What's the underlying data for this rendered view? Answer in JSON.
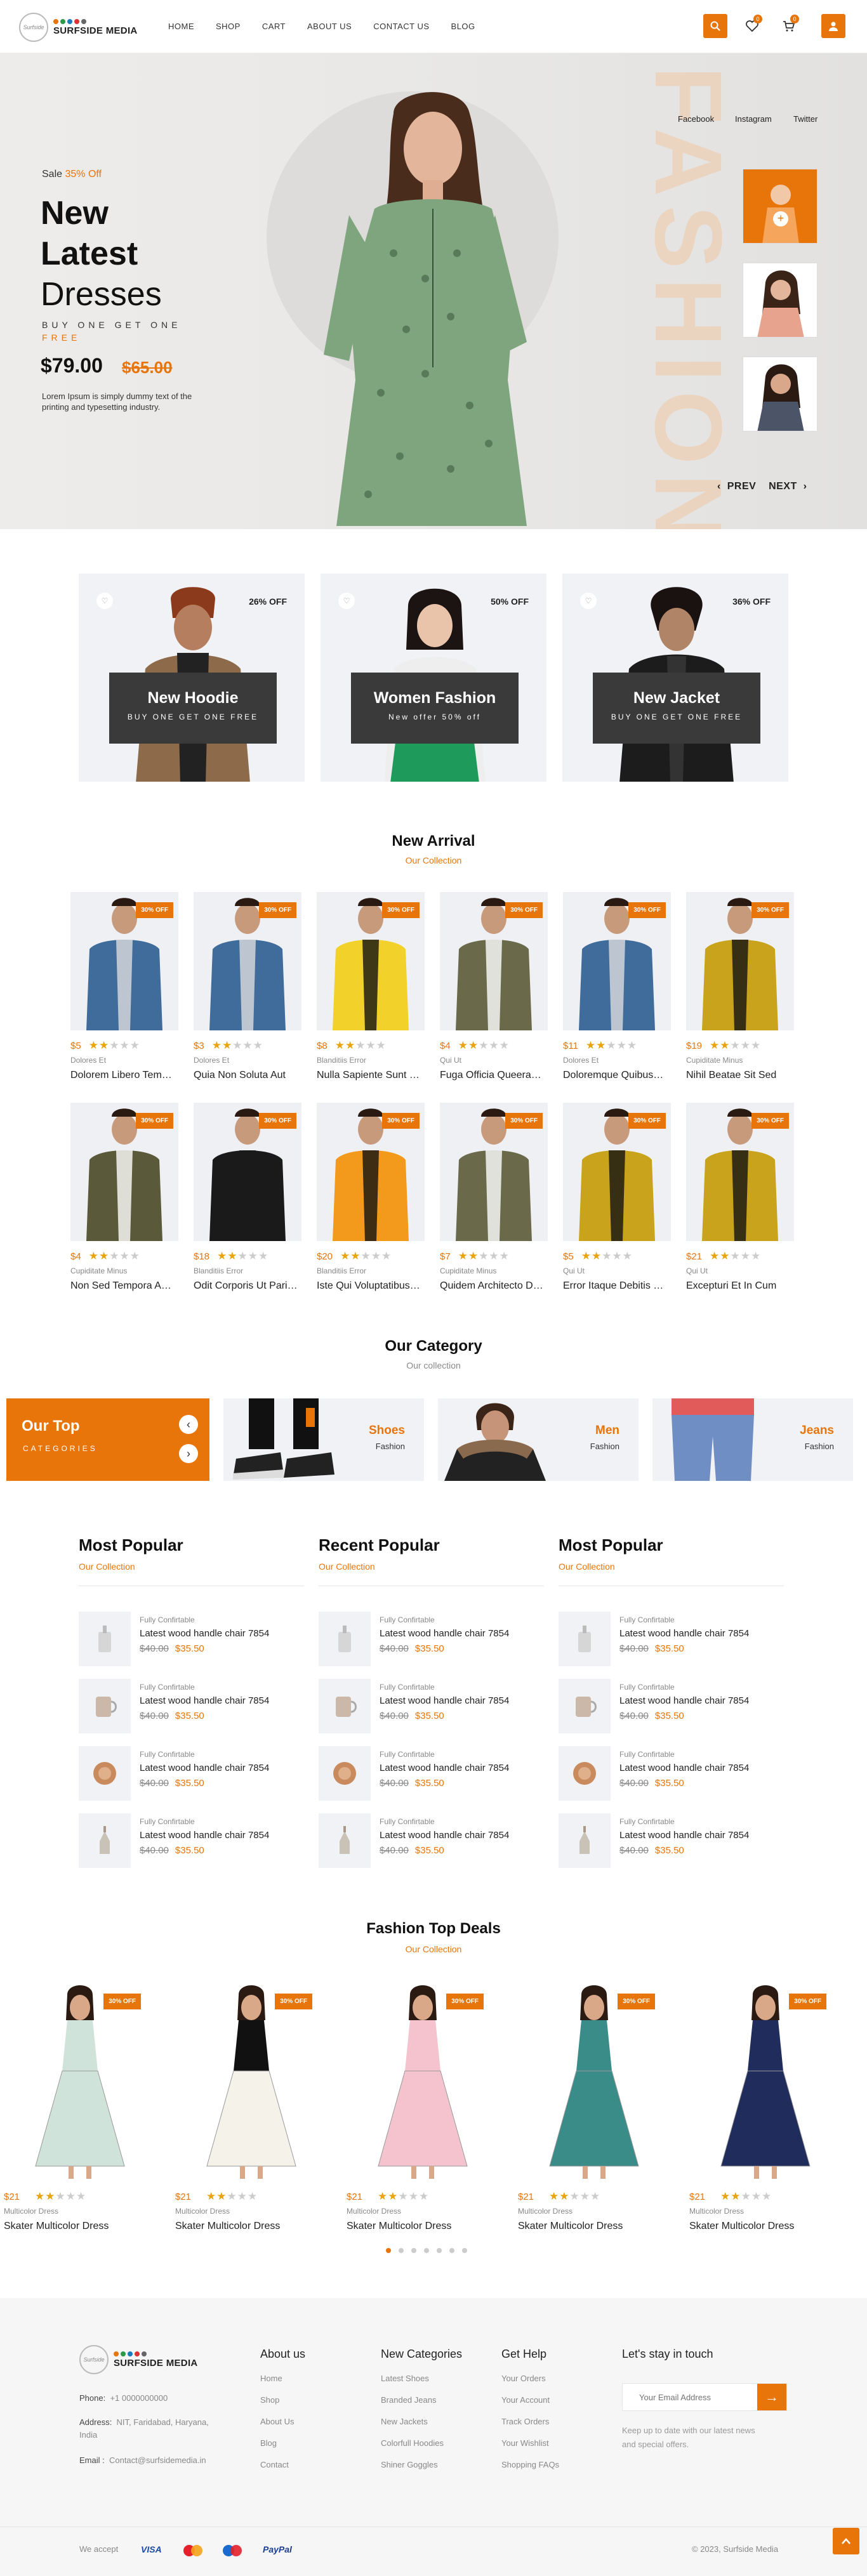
{
  "header": {
    "logo_text": "SURFSIDE MEDIA",
    "logo_script": "Surfside",
    "nav": [
      "HOME",
      "SHOP",
      "CART",
      "ABOUT US",
      "CONTACT US",
      "BLOG"
    ],
    "wishlist_count": "0",
    "cart_count": "0"
  },
  "hero": {
    "sale_label": "Sale",
    "sale_off": "35% Off",
    "title_line1": "New",
    "title_line2": "Latest",
    "title_line3": "Dresses",
    "buy_text": "BUY ONE GET ONE",
    "free_text": "FREE",
    "price": "$79.00",
    "old_price": "$65.00",
    "description": "Lorem Ipsum is simply dummy text of the printing and typesetting industry.",
    "bg_word": "FASHION",
    "social": [
      "Facebook",
      "Instagram",
      "Twitter"
    ],
    "prev": "PREV",
    "next": "NEXT"
  },
  "promos": [
    {
      "off": "26% OFF",
      "title": "New Hoodie",
      "subtitle": "BUY ONE GET ONE FREE"
    },
    {
      "off": "50% OFF",
      "title": "Women Fashion",
      "subtitle": "New offer 50% off"
    },
    {
      "off": "36% OFF",
      "title": "New Jacket",
      "subtitle": "BUY ONE GET ONE FREE"
    }
  ],
  "new_arrival": {
    "title": "New Arrival",
    "subtitle": "Our Collection",
    "tag": "30% OFF",
    "products": [
      {
        "price": "$5",
        "rating": 2,
        "category": "Dolores Et",
        "name": "Dolorem Libero Tem…"
      },
      {
        "price": "$3",
        "rating": 2,
        "category": "Dolores Et",
        "name": "Quia Non Soluta Aut"
      },
      {
        "price": "$8",
        "rating": 2,
        "category": "Blanditiis Error",
        "name": "Nulla Sapiente Sunt …"
      },
      {
        "price": "$4",
        "rating": 2,
        "category": "Qui Ut",
        "name": "Fuga Officia Queera…"
      },
      {
        "price": "$11",
        "rating": 2,
        "category": "Dolores Et",
        "name": "Doloremque Quibus…"
      },
      {
        "price": "$19",
        "rating": 2,
        "category": "Cupiditate Minus",
        "name": "Nihil Beatae Sit Sed"
      },
      {
        "price": "$4",
        "rating": 2,
        "category": "Cupiditate Minus",
        "name": "Non Sed Tempora A…"
      },
      {
        "price": "$18",
        "rating": 2,
        "category": "Blanditiis Error",
        "name": "Odit Corporis Ut Pari…"
      },
      {
        "price": "$20",
        "rating": 2,
        "category": "Blanditiis Error",
        "name": "Iste Qui Voluptatibus…"
      },
      {
        "price": "$7",
        "rating": 2,
        "category": "Cupiditate Minus",
        "name": "Quidem Architecto D…"
      },
      {
        "price": "$5",
        "rating": 2,
        "category": "Qui Ut",
        "name": "Error Itaque Debitis …"
      },
      {
        "price": "$21",
        "rating": 2,
        "category": "Qui Ut",
        "name": "Excepturi Et In Cum"
      }
    ]
  },
  "category": {
    "title": "Our Category",
    "subtitle": "Our collection",
    "top_title": "Our Top",
    "top_sub": "CATEGORIES",
    "items": [
      {
        "name": "Shoes",
        "sub": "Fashion"
      },
      {
        "name": "Men",
        "sub": "Fashion"
      },
      {
        "name": "Jeans",
        "sub": "Fashion"
      }
    ]
  },
  "lists": [
    {
      "title": "Most Popular",
      "subtitle": "Our Collection"
    },
    {
      "title": "Recent Popular",
      "subtitle": "Our Collection"
    },
    {
      "title": "Most Popular",
      "subtitle": "Our Collection"
    }
  ],
  "list_item": {
    "category": "Fully Confirtable",
    "items": [
      {
        "name": "Latest wood handle chair 7854",
        "old": "$40.00",
        "price": "$35.50"
      },
      {
        "name": "Latest wood handle chair 7854",
        "old": "$40.00",
        "price": "$35.50"
      },
      {
        "name": "Latest wood handle chair 7854",
        "old": "$40.00",
        "price": "$35.50"
      },
      {
        "name": "Latest wood handle chair 7854",
        "old": "$40.00",
        "price": "$35.50"
      }
    ]
  },
  "deals": {
    "title": "Fashion Top Deals",
    "subtitle": "Our Collection",
    "tag": "30% OFF",
    "products": [
      {
        "price": "$21",
        "rating": 2,
        "category": "Multicolor Dress",
        "name": "Skater Multicolor Dress"
      },
      {
        "price": "$21",
        "rating": 2,
        "category": "Multicolor Dress",
        "name": "Skater Multicolor Dress"
      },
      {
        "price": "$21",
        "rating": 2,
        "category": "Multicolor Dress",
        "name": "Skater Multicolor Dress"
      },
      {
        "price": "$21",
        "rating": 2,
        "category": "Multicolor Dress",
        "name": "Skater Multicolor Dress"
      },
      {
        "price": "$21",
        "rating": 2,
        "category": "Multicolor Dress",
        "name": "Skater Multicolor Dress"
      }
    ],
    "active_dot": 0
  },
  "footer": {
    "logo_text": "SURFSIDE MEDIA",
    "phone_label": "Phone:",
    "phone": "+1 0000000000",
    "address_label": "Address:",
    "address": "NIT, Faridabad, Haryana, India",
    "email_label": "Email :",
    "email": "Contact@surfsidemedia.in",
    "about_title": "About us",
    "about_links": [
      "Home",
      "Shop",
      "About Us",
      "Blog",
      "Contact"
    ],
    "cat_title": "New Categories",
    "cat_links": [
      "Latest Shoes",
      "Branded Jeans",
      "New Jackets",
      "Colorfull Hoodies",
      "Shiner Goggles"
    ],
    "help_title": "Get Help",
    "help_links": [
      "Your Orders",
      "Your Account",
      "Track Orders",
      "Your Wishlist",
      "Shopping FAQs"
    ],
    "news_title": "Let's stay in touch",
    "news_placeholder": "Your Email Address",
    "news_note": "Keep up to date with our latest news and special offers.",
    "we_accept": "We accept",
    "payments": [
      "VISA",
      "MC",
      "MC",
      "PayPal"
    ],
    "copyright": "© 2023, Surfside Media"
  },
  "colors": {
    "accent": "#e8750a",
    "dark": "#111111"
  }
}
